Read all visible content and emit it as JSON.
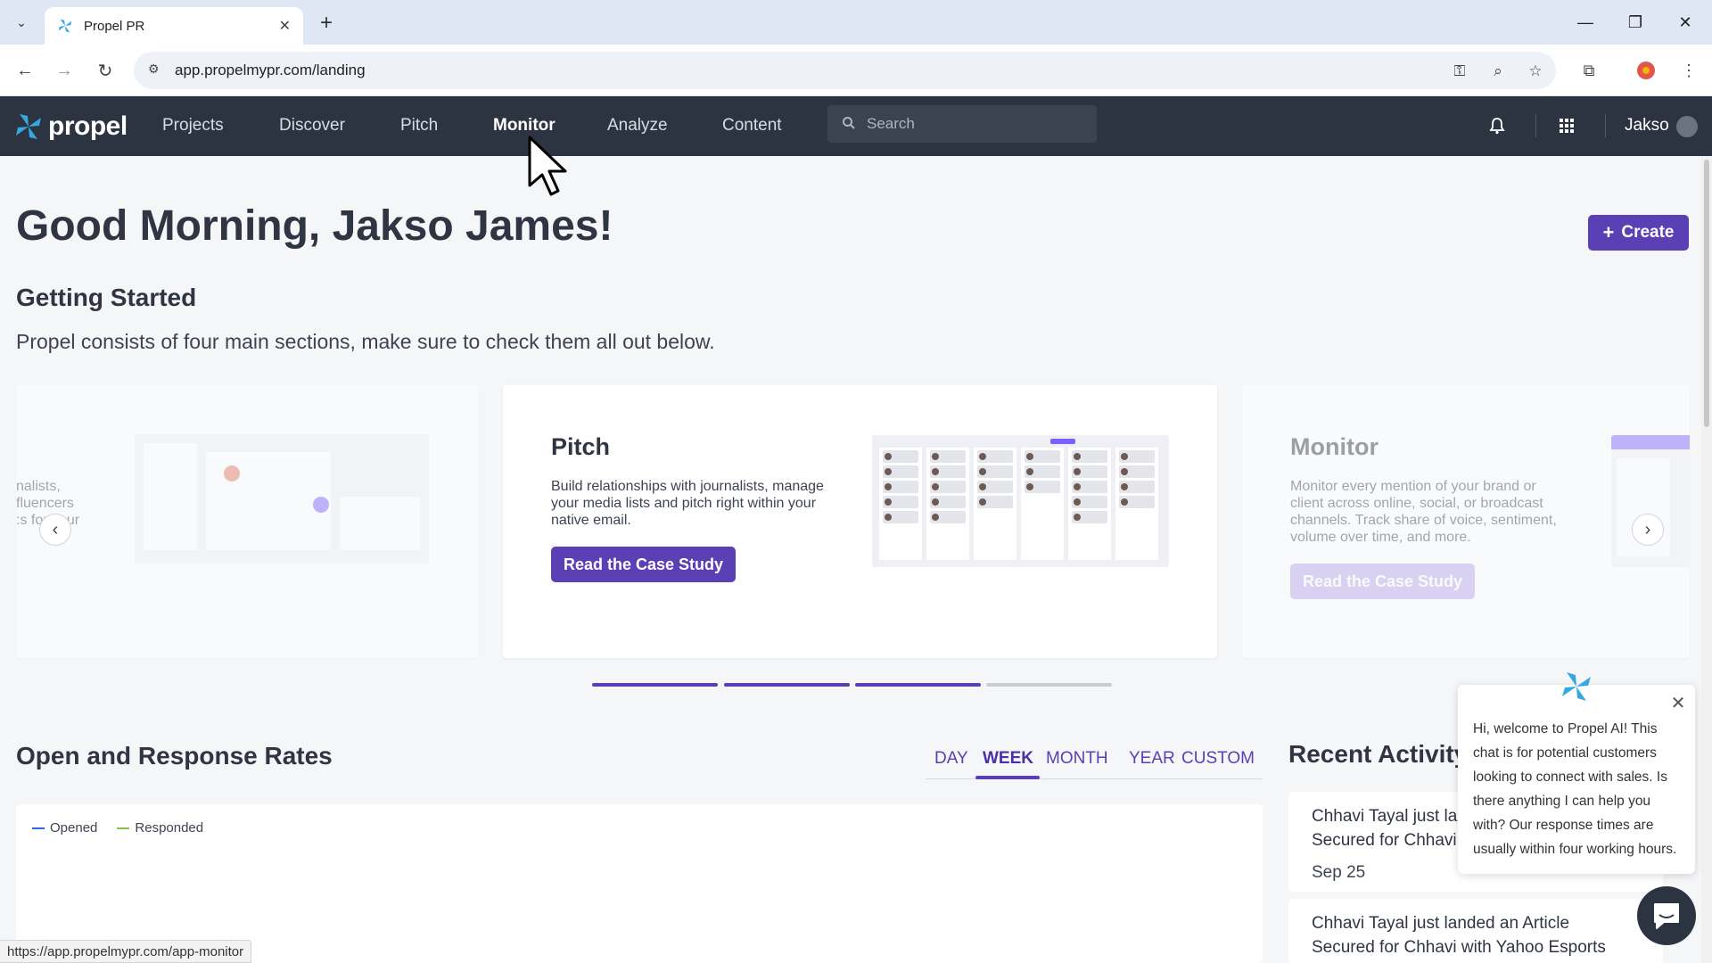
{
  "browser": {
    "tab_title": "Propel PR",
    "url": "app.propelmypr.com/landing",
    "status_url": "https://app.propelmypr.com/app-monitor"
  },
  "header": {
    "logo_text": "propel",
    "nav": [
      "Projects",
      "Discover",
      "Pitch",
      "Monitor",
      "Analyze",
      "Content"
    ],
    "active_nav": "Monitor",
    "search_placeholder": "Search",
    "user_name": "Jakso"
  },
  "main": {
    "greeting": "Good Morning, Jakso James!",
    "create_label": "Create",
    "getting_started_title": "Getting Started",
    "getting_started_desc": "Propel consists of four main sections, make sure to check them all out below.",
    "cards": [
      {
        "title": "",
        "desc": "nalists,\nfluencers\n:s for your"
      },
      {
        "title": "Pitch",
        "desc": "Build relationships with journalists, manage your media lists and pitch right within your native email.",
        "button": "Read the Case Study"
      },
      {
        "title": "Monitor",
        "desc": "Monitor every mention of your brand or client across online, social, or broadcast channels. Track share of voice, sentiment, volume over time, and more.",
        "button": "Read the Case Study"
      }
    ],
    "carousel_active_dots": 3,
    "carousel_total_dots": 4
  },
  "rates": {
    "title": "Open and Response Rates",
    "ranges": [
      "DAY",
      "WEEK",
      "MONTH",
      "YEAR",
      "CUSTOM"
    ],
    "active_range": "WEEK",
    "legend": [
      {
        "name": "Opened",
        "color": "#2d6cdf"
      },
      {
        "name": "Responded",
        "color": "#8bc34a"
      }
    ]
  },
  "activity": {
    "title": "Recent Activity",
    "items": [
      {
        "text": "Chhavi Tayal just la\nSecured for Chhavi",
        "date": "Sep 25"
      },
      {
        "text": "Chhavi Tayal just landed an Article\nSecured for Chhavi with Yahoo Esports",
        "date": ""
      }
    ]
  },
  "chat": {
    "message": "Hi, welcome to Propel AI! This chat is for potential customers looking to connect with sales. Is there anything I can help you with? Our response times are usually within four working hours."
  },
  "colors": {
    "accent": "#5b3fb5",
    "nav_bg": "#2c3441"
  }
}
